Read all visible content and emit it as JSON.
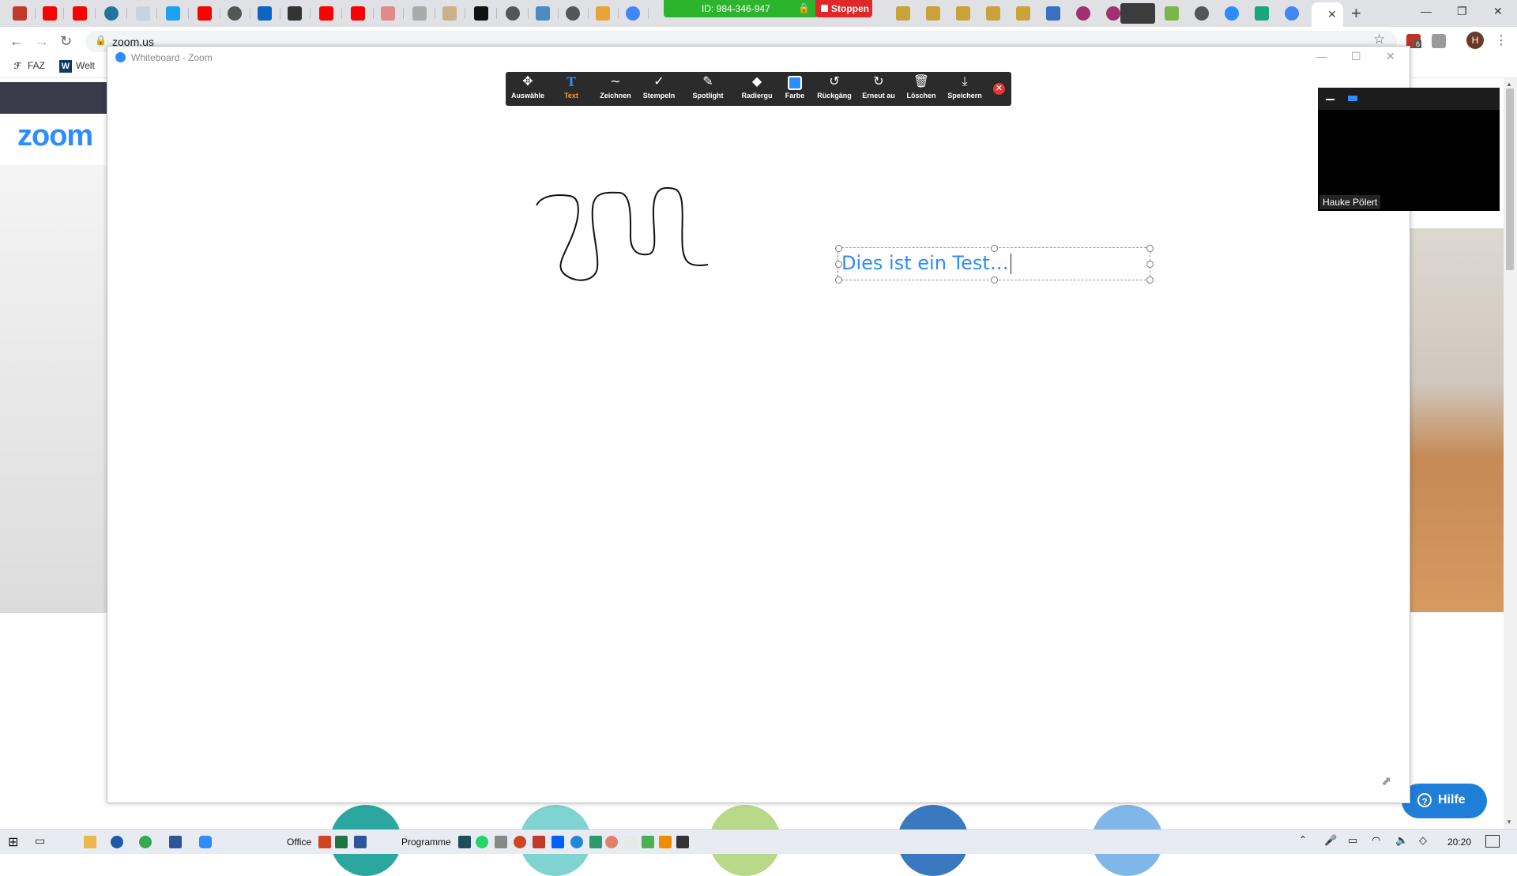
{
  "browser": {
    "url": "zoom.us",
    "bookmarks": [
      {
        "label": "FAZ",
        "icon": "faz-icon"
      },
      {
        "label": "Welt",
        "icon": "welt-icon"
      }
    ],
    "avatar_letter": "H",
    "extension_badge": "6"
  },
  "meeting": {
    "id_label": "ID: 984-346-947",
    "stop_label": "Stoppen"
  },
  "whiteboard": {
    "window_title": "Whiteboard - Zoom",
    "tools": [
      {
        "label": "Auswähle",
        "icon": "move-arrows-icon",
        "active": false
      },
      {
        "label": "Text",
        "icon": "text-icon",
        "active": true
      },
      {
        "label": "Zeichnen",
        "icon": "draw-icon",
        "active": false
      },
      {
        "label": "Stempeln",
        "icon": "stamp-check-icon",
        "active": false
      },
      {
        "label": "Spotlight",
        "icon": "spotlight-icon",
        "active": false
      },
      {
        "label": "Radiergu",
        "icon": "eraser-icon",
        "active": false
      },
      {
        "label": "Farbe",
        "icon": "color-swatch-icon",
        "active": false
      },
      {
        "label": "Rückgäng",
        "icon": "undo-icon",
        "active": false
      },
      {
        "label": "Erneut au",
        "icon": "redo-icon",
        "active": false
      },
      {
        "label": "Löschen",
        "icon": "trash-icon",
        "active": false
      },
      {
        "label": "Speichern",
        "icon": "save-icon",
        "active": false
      }
    ],
    "text_content": "Dies ist ein Test…",
    "text_color": "#2d8cff"
  },
  "video": {
    "participant_name": "Hauke Pölert"
  },
  "page": {
    "logo": "zoom",
    "help_label": "Hilfe"
  },
  "taskbar": {
    "groups": [
      "Office",
      "Programme"
    ],
    "time": "20:20"
  },
  "colors": {
    "accent": "#2d8cff",
    "meeting_green": "#2cb52c",
    "stop_red": "#e02828",
    "toolbar_bg": "#2b2b2b",
    "active_label": "#ff9b2f"
  }
}
